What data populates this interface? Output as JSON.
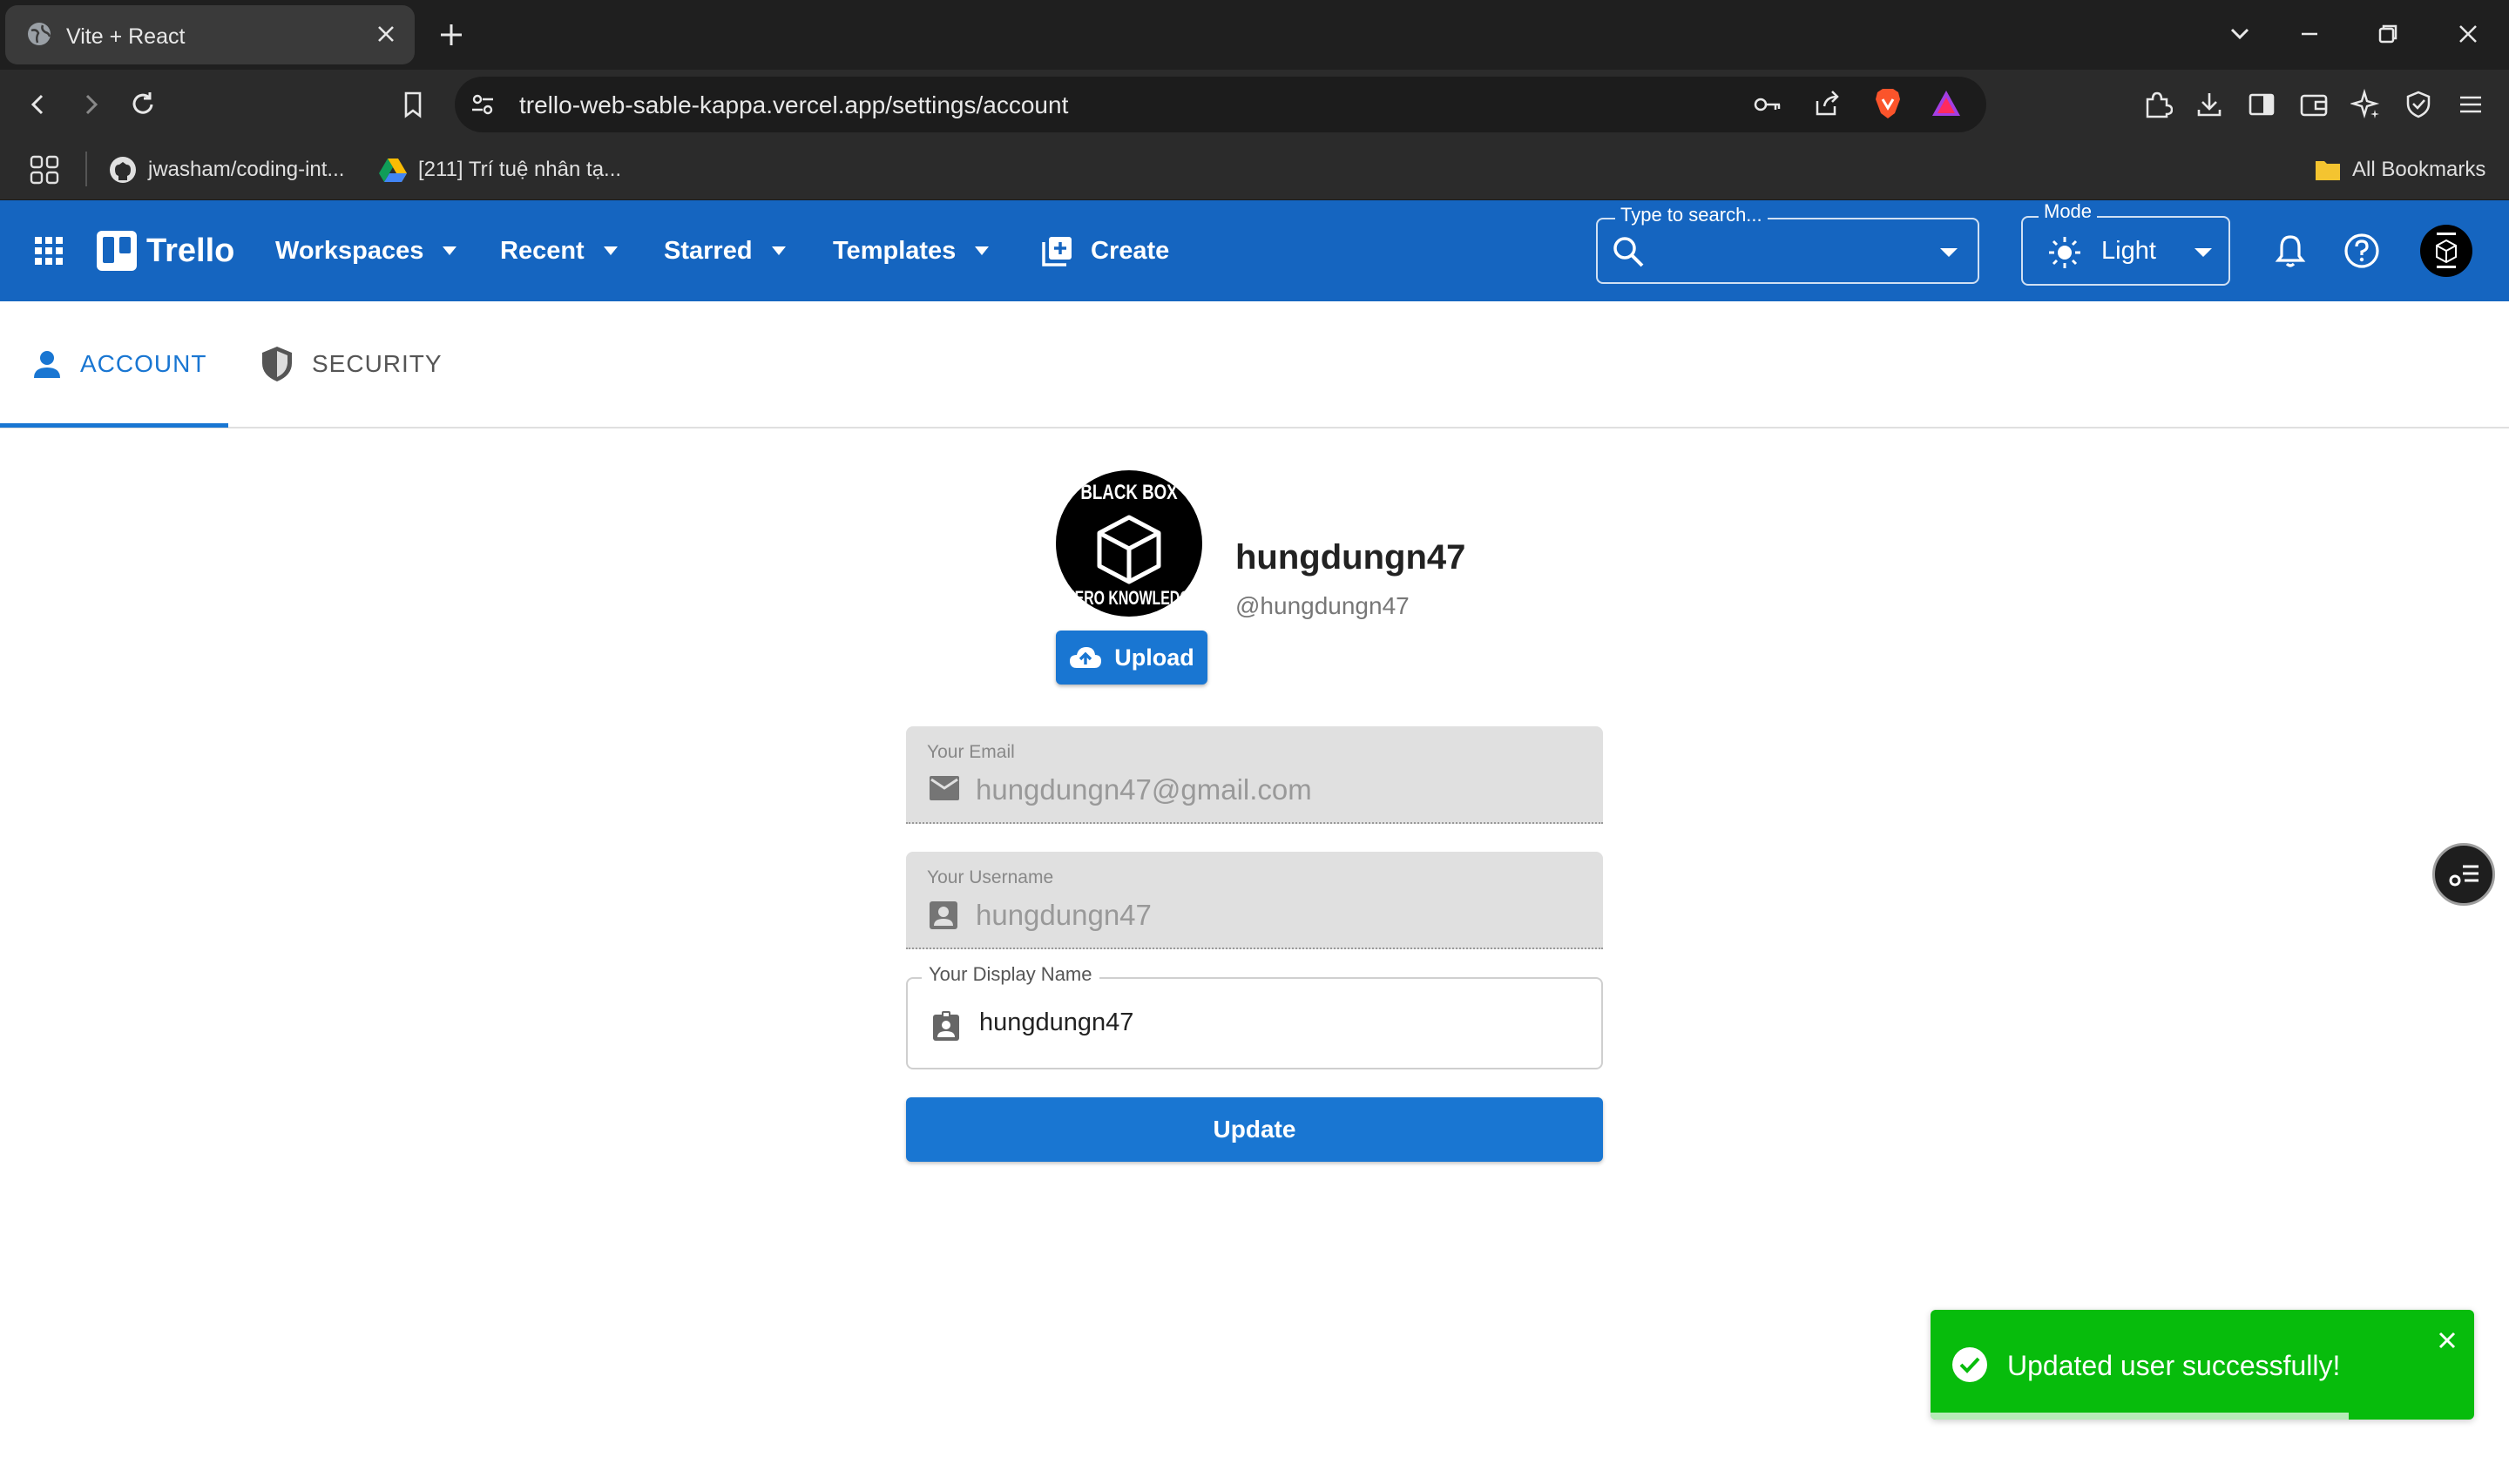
{
  "browser": {
    "tab_title": "Vite + React",
    "url": "trello-web-sable-kappa.vercel.app/settings/account",
    "bookmarks": [
      {
        "label": "jwasham/coding-int...",
        "icon": "github-icon"
      },
      {
        "label": "[211] Trí tuệ nhân tạ...",
        "icon": "google-drive-icon"
      }
    ],
    "all_bookmarks": "All Bookmarks"
  },
  "appbar": {
    "brand": "Trello",
    "nav": {
      "workspaces": "Workspaces",
      "recent": "Recent",
      "starred": "Starred",
      "templates": "Templates",
      "create": "Create"
    },
    "search": {
      "legend": "Type to search...",
      "value": ""
    },
    "mode": {
      "legend": "Mode",
      "value": "Light"
    },
    "color": "#1565c0"
  },
  "settings_tabs": [
    {
      "label": "ACCOUNT",
      "active": true
    },
    {
      "label": "SECURITY",
      "active": false
    }
  ],
  "profile": {
    "display_name": "hungdungn47",
    "handle": "@hungdungn47",
    "avatar": {
      "top_text": "BLACK BOX",
      "bottom_text": "ZERO KNOWLEDGE"
    },
    "upload_label": "Upload"
  },
  "form": {
    "email": {
      "label": "Your Email",
      "value": "hungdungn47@gmail.com"
    },
    "username": {
      "label": "Your Username",
      "value": "hungdungn47"
    },
    "display_name": {
      "label": "Your Display Name",
      "value": "hungdungn47"
    },
    "submit_label": "Update",
    "accent": "#1976d2"
  },
  "toast": {
    "message": "Updated user successfully!",
    "color": "#07bc0c",
    "remaining_fraction": 0.77
  }
}
